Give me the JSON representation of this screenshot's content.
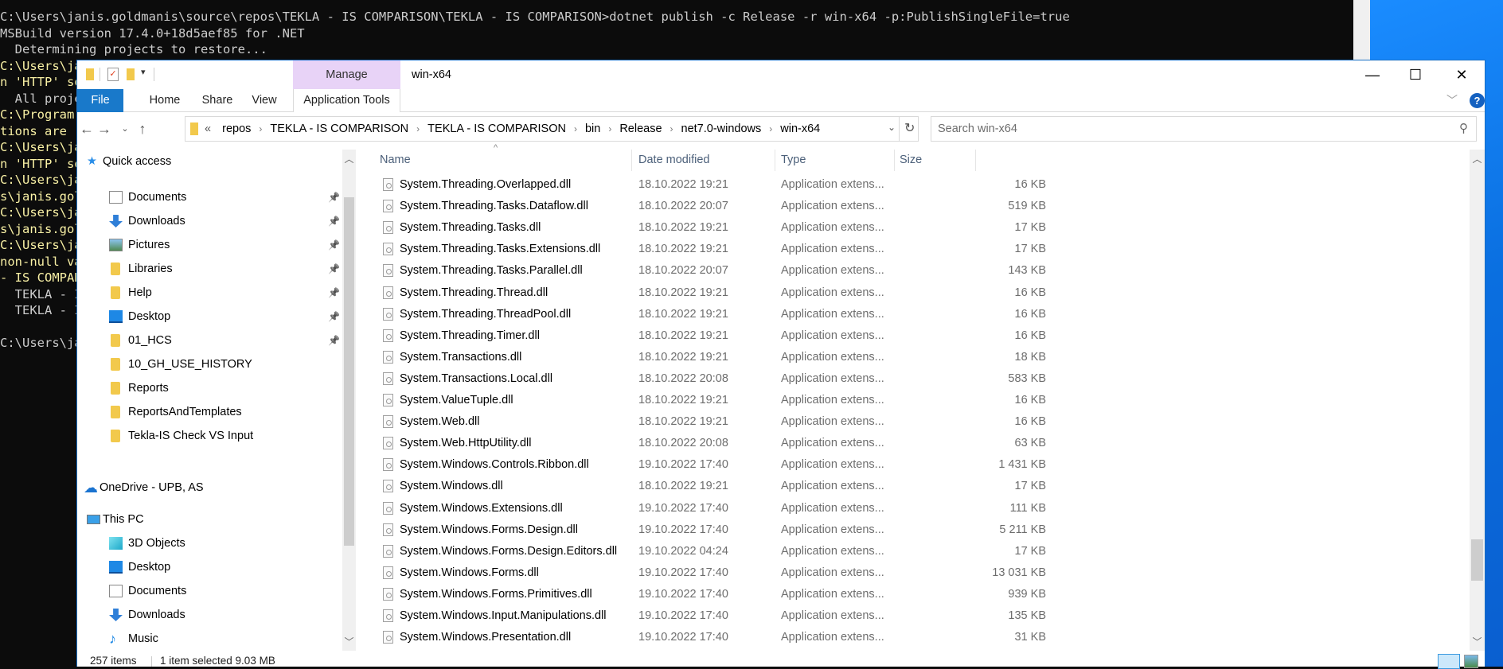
{
  "terminal": {
    "lines": [
      {
        "text": "C:\\Users\\janis.goldmanis\\source\\repos\\TEKLA - IS COMPARISON\\TEKLA - IS COMPARISON>dotnet publish -c Release -r win-x64 -p:PublishSingleFile=true",
        "warn": false
      },
      {
        "text": "MSBuild version 17.4.0+18d5aef85 for .NET",
        "warn": false
      },
      {
        "text": "  Determining projects to restore...",
        "warn": false
      },
      {
        "text": "C:\\Users\\ja",
        "warn": true
      },
      {
        "text": "n 'HTTP' so",
        "warn": true
      },
      {
        "text": "  All proje",
        "warn": false
      },
      {
        "text": "C:\\Program ",
        "warn": true
      },
      {
        "text": "tions are r",
        "warn": true
      },
      {
        "text": "C:\\Users\\ja",
        "warn": true
      },
      {
        "text": "n 'HTTP' so",
        "warn": true
      },
      {
        "text": "C:\\Users\\ja",
        "warn": true
      },
      {
        "text": "s\\janis.gol",
        "warn": true
      },
      {
        "text": "C:\\Users\\ja",
        "warn": true
      },
      {
        "text": "s\\janis.gol",
        "warn": true
      },
      {
        "text": "C:\\Users\\ja",
        "warn": true
      },
      {
        "text": "non-null va",
        "warn": true
      },
      {
        "text": "- IS COMPAR",
        "warn": true
      },
      {
        "text": "  TEKLA - I",
        "warn": false
      },
      {
        "text": "  TEKLA - I",
        "warn": false
      },
      {
        "text": "",
        "warn": false
      },
      {
        "text": "C:\\Users\\ja",
        "warn": false
      }
    ]
  },
  "window": {
    "title": "win-x64",
    "context_tab": "Manage",
    "controls": {
      "minimize": "—",
      "maximize": "☐",
      "close": "✕"
    }
  },
  "ribbon": {
    "tabs": [
      "File",
      "Home",
      "Share",
      "View"
    ],
    "context_tab": "Application Tools",
    "help": "?"
  },
  "address": {
    "overflow": "«",
    "crumbs": [
      "repos",
      "TEKLA - IS COMPARISON",
      "TEKLA - IS COMPARISON",
      "bin",
      "Release",
      "net7.0-windows",
      "win-x64"
    ],
    "search_placeholder": "Search win-x64"
  },
  "nav": {
    "quick_access": "Quick access",
    "quick_items": [
      {
        "label": "Documents",
        "icon": "documents",
        "pinned": true
      },
      {
        "label": "Downloads",
        "icon": "downloads",
        "pinned": true
      },
      {
        "label": "Pictures",
        "icon": "pictures",
        "pinned": true
      },
      {
        "label": "Libraries",
        "icon": "folder",
        "pinned": true
      },
      {
        "label": "Help",
        "icon": "folder",
        "pinned": true
      },
      {
        "label": "Desktop",
        "icon": "desktop",
        "pinned": true
      },
      {
        "label": "01_HCS",
        "icon": "folder",
        "pinned": true
      },
      {
        "label": "10_GH_USE_HISTORY",
        "icon": "folder",
        "pinned": false
      },
      {
        "label": "Reports",
        "icon": "folder",
        "pinned": false
      },
      {
        "label": "ReportsAndTemplates",
        "icon": "folder",
        "pinned": false
      },
      {
        "label": "Tekla-IS Check VS Input",
        "icon": "folder",
        "pinned": false
      }
    ],
    "onedrive": "OneDrive - UPB, AS",
    "this_pc": "This PC",
    "pc_items": [
      {
        "label": "3D Objects",
        "icon": "3d-objects"
      },
      {
        "label": "Desktop",
        "icon": "desktop"
      },
      {
        "label": "Documents",
        "icon": "documents"
      },
      {
        "label": "Downloads",
        "icon": "downloads"
      },
      {
        "label": "Music",
        "icon": "music"
      },
      {
        "label": "Pictures",
        "icon": "pictures"
      }
    ]
  },
  "list": {
    "columns": {
      "name": "Name",
      "date": "Date modified",
      "type": "Type",
      "size": "Size"
    },
    "rows": [
      [
        "System.Threading.Overlapped.dll",
        "18.10.2022 19:21",
        "Application extens...",
        "16 KB"
      ],
      [
        "System.Threading.Tasks.Dataflow.dll",
        "18.10.2022 20:07",
        "Application extens...",
        "519 KB"
      ],
      [
        "System.Threading.Tasks.dll",
        "18.10.2022 19:21",
        "Application extens...",
        "17 KB"
      ],
      [
        "System.Threading.Tasks.Extensions.dll",
        "18.10.2022 19:21",
        "Application extens...",
        "17 KB"
      ],
      [
        "System.Threading.Tasks.Parallel.dll",
        "18.10.2022 20:07",
        "Application extens...",
        "143 KB"
      ],
      [
        "System.Threading.Thread.dll",
        "18.10.2022 19:21",
        "Application extens...",
        "16 KB"
      ],
      [
        "System.Threading.ThreadPool.dll",
        "18.10.2022 19:21",
        "Application extens...",
        "16 KB"
      ],
      [
        "System.Threading.Timer.dll",
        "18.10.2022 19:21",
        "Application extens...",
        "16 KB"
      ],
      [
        "System.Transactions.dll",
        "18.10.2022 19:21",
        "Application extens...",
        "18 KB"
      ],
      [
        "System.Transactions.Local.dll",
        "18.10.2022 20:08",
        "Application extens...",
        "583 KB"
      ],
      [
        "System.ValueTuple.dll",
        "18.10.2022 19:21",
        "Application extens...",
        "16 KB"
      ],
      [
        "System.Web.dll",
        "18.10.2022 19:21",
        "Application extens...",
        "16 KB"
      ],
      [
        "System.Web.HttpUtility.dll",
        "18.10.2022 20:08",
        "Application extens...",
        "63 KB"
      ],
      [
        "System.Windows.Controls.Ribbon.dll",
        "19.10.2022 17:40",
        "Application extens...",
        "1 431 KB"
      ],
      [
        "System.Windows.dll",
        "18.10.2022 19:21",
        "Application extens...",
        "17 KB"
      ],
      [
        "System.Windows.Extensions.dll",
        "19.10.2022 17:40",
        "Application extens...",
        "111 KB"
      ],
      [
        "System.Windows.Forms.Design.dll",
        "19.10.2022 17:40",
        "Application extens...",
        "5 211 KB"
      ],
      [
        "System.Windows.Forms.Design.Editors.dll",
        "19.10.2022 04:24",
        "Application extens...",
        "17 KB"
      ],
      [
        "System.Windows.Forms.dll",
        "19.10.2022 17:40",
        "Application extens...",
        "13 031 KB"
      ],
      [
        "System.Windows.Forms.Primitives.dll",
        "19.10.2022 17:40",
        "Application extens...",
        "939 KB"
      ],
      [
        "System.Windows.Input.Manipulations.dll",
        "19.10.2022 17:40",
        "Application extens...",
        "135 KB"
      ],
      [
        "System.Windows.Presentation.dll",
        "19.10.2022 17:40",
        "Application extens...",
        "31 KB"
      ]
    ],
    "scroll_position": 0.87
  },
  "status": {
    "count": "257 items",
    "selection": "1 item selected  9.03 MB"
  },
  "colors": {
    "file_tab": "#1979ca",
    "manage_tab": "#e8d3f7",
    "terminal_bg": "#0c0c0c",
    "terminal_warn": "#f9f1a5"
  }
}
